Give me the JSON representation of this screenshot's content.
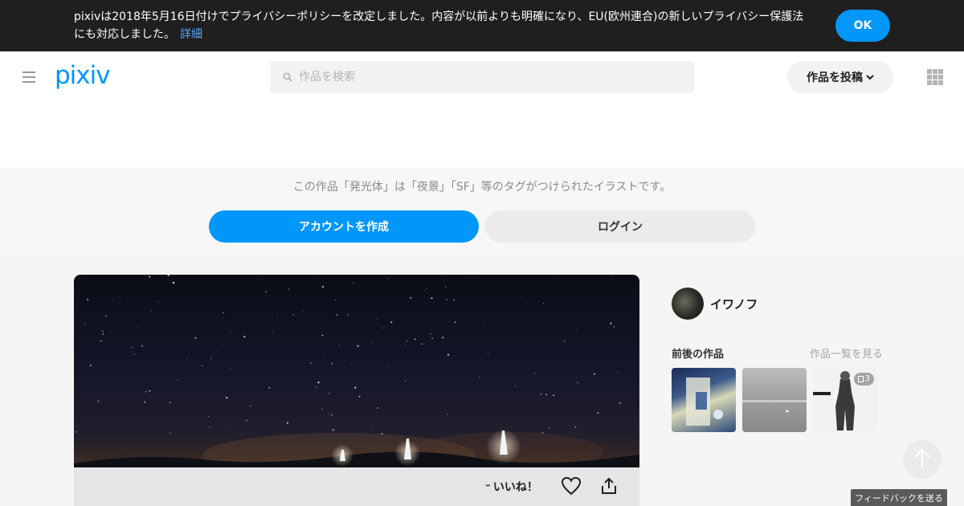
{
  "banner": {
    "text": "pixivは2018年5月16日付けでプライバシーポリシーを改定しました。内容が以前よりも明確になり、EU(欧州連合)の新しいプライバシー保護法にも対応しました。",
    "link_label": "詳細",
    "ok_label": "OK"
  },
  "header": {
    "logo_text": "pixiv",
    "search_placeholder": "作品を検索",
    "search_value": "",
    "post_label": "作品を投稿",
    "icons": [
      "menu-icon",
      "search-icon",
      "chevron-down-icon",
      "apps-grid-icon"
    ]
  },
  "promo": {
    "text": "この作品「発光体」は「夜景」「SF」等のタグがつけられたイラストです。",
    "signup_label": "アカウントを作成",
    "login_label": "ログイン"
  },
  "artwork": {
    "like_label": "いいね！",
    "like_icon": "smile-icon",
    "heart_icon": "heart-icon",
    "share_icon": "share-icon"
  },
  "sidebar": {
    "author_name": "イワノフ",
    "related_title": "前後の作品",
    "related_more": "作品一覧を見る",
    "thumbs": [
      {
        "count": ""
      },
      {
        "count": ""
      },
      {
        "count": "3"
      }
    ]
  },
  "footer": {
    "feedback_label": "フィードバックを送る"
  },
  "colors": {
    "accent": "#0096fa",
    "banner_bg": "#1f1f1f"
  }
}
